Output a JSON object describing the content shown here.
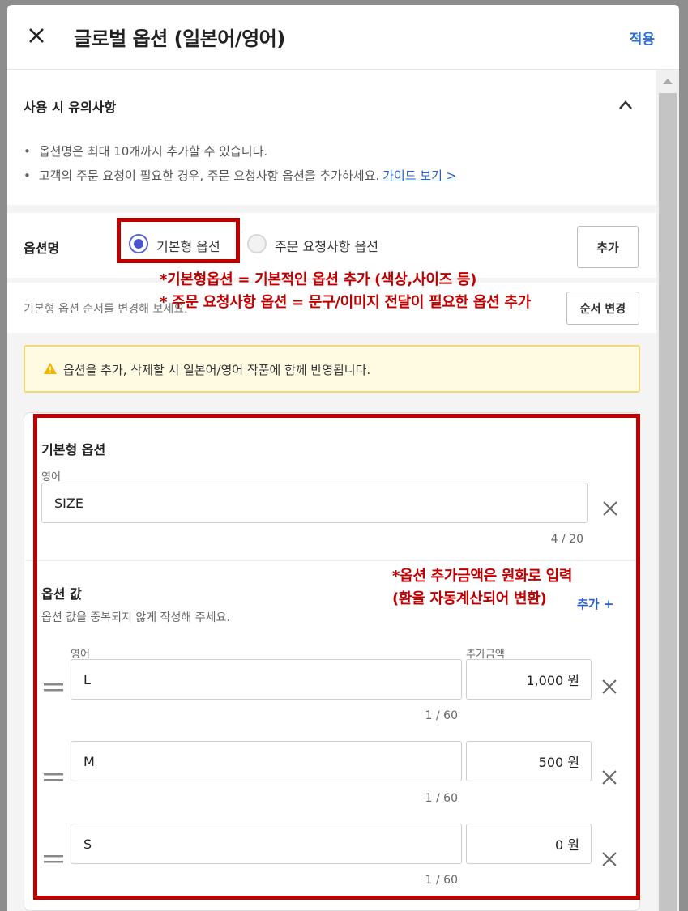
{
  "header": {
    "title": "글로벌 옵션 (일본어/영어)",
    "apply_label": "적용"
  },
  "notice": {
    "title": "사용 시 유의사항",
    "bullets": [
      "옵션명은 최대 10개까지 추가할 수 있습니다.",
      "고객의 주문 요청이 필요한 경우, 주문 요청사항 옵션을 추가하세요."
    ],
    "guide_link": "가이드 보기 >"
  },
  "option_name": {
    "label": "옵션명",
    "radio_basic": "기본형 옵션",
    "radio_request": "주문 요청사항 옵션",
    "selected": "기본형 옵션",
    "add_button": "추가"
  },
  "annotations": {
    "line1": "*기본형옵션 = 기본적인 옵션 추가 (색상,사이즈 등)",
    "line2": "* 주문 요청사항 옵션 = 문구/이미지 전달이 필요한 옵션 추가",
    "price_line1": "*옵션 추가금액은 원화로 입력",
    "price_line2": "(환율 자동계산되어 변환)"
  },
  "order": {
    "text": "기본형 옵션 순서를 변경해 보세요.",
    "button": "순서 변경"
  },
  "warning": {
    "text": "옵션을 추가, 삭제할 시 일본어/영어 작품에 함께 반영됩니다."
  },
  "card": {
    "title": "기본형 옵션",
    "lang_label": "영어",
    "option_name_value": "SIZE",
    "option_name_counter": "4 / 20",
    "values_title": "옵션 값",
    "values_desc": "옵션 값을 중복되지 않게 작성해 주세요.",
    "add_value_label": "추가 +",
    "col_lang": "영어",
    "col_price": "추가금액",
    "rows": [
      {
        "value": "L",
        "price": "1,000 원",
        "counter": "1 / 60"
      },
      {
        "value": "M",
        "price": "500 원",
        "counter": "1 / 60"
      },
      {
        "value": "S",
        "price": "0 원",
        "counter": "1 / 60"
      }
    ]
  },
  "colors": {
    "accent_blue": "#2a6fd6",
    "annotation_red": "#c00000",
    "radio_selected": "#4a56d0",
    "warning_bg": "#fffbe3",
    "warning_border": "#f2d977"
  },
  "icons": [
    "close-icon",
    "chevron-up-icon",
    "warning-icon",
    "drag-handle-icon",
    "delete-icon",
    "scroll-up-icon"
  ]
}
